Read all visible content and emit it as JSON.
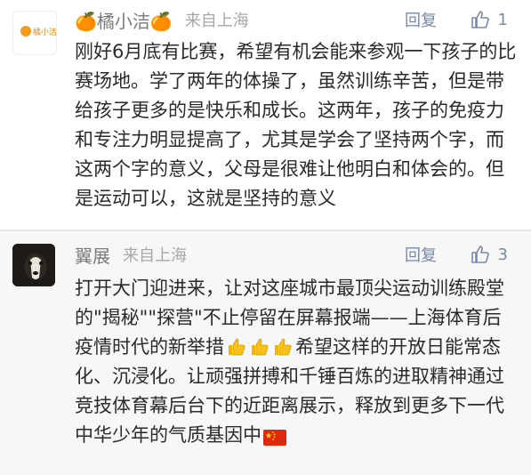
{
  "comments": [
    {
      "user_name": "🍊橘小洁🍊",
      "avatar_text": "橘小洁",
      "location": "来自上海",
      "reply_label": "回复",
      "like_count": "1",
      "body": "刚好6月底有比赛，希望有机会能来参观一下孩子的比赛场地。学了两年的体操了，虽然训练辛苦，但是带给孩子更多的是快乐和成长。这两年，孩子的免疫力和专注力明显提高了，尤其是学会了坚持两个字，而这两个字的意义，父母是很难让他明白和体会的。但是运动可以，这就是坚持的意义"
    },
    {
      "user_name": "翼展",
      "location": "来自上海",
      "reply_label": "回复",
      "like_count": "3",
      "body_before": "打开大门迎进来，让对这座城市最顶尖运动训练殿堂的\"揭秘\"\"探营\"不止停留在屏幕报端——上海体育后疫情时代的新举措",
      "body_after": "希望这样的开放日能常态化、沉浸化。让顽强拼搏和千锤百炼的进取精神通过竞技体育幕后台下的近距离展示，释放到更多下一代中华少年的气质基因中",
      "emojis": [
        "thumbs-up-icon",
        "thumbs-up-icon",
        "thumbs-up-icon"
      ],
      "flag": "china-flag-icon"
    }
  ],
  "colors": {
    "meta": "#a7a7a7",
    "action": "#7a88aa",
    "text": "#2a2a2a"
  }
}
